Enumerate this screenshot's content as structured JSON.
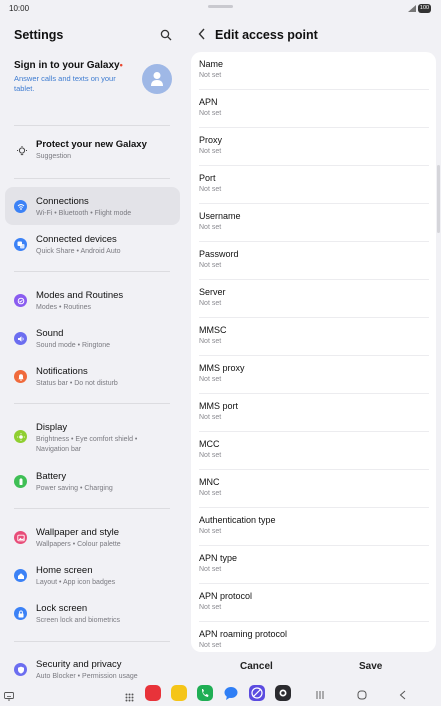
{
  "status_bar": {
    "time": "10:00",
    "battery": "100"
  },
  "settings": {
    "title": "Settings",
    "signin": {
      "title": "Sign in to your Galaxy",
      "subtitle": "Answer calls and texts on your tablet."
    },
    "suggestion": {
      "label": "Protect your new Galaxy",
      "sub": "Suggestion"
    },
    "items": [
      {
        "label": "Connections",
        "sub": "Wi-Fi  •  Bluetooth  •  Flight mode",
        "color": "#3c82f6",
        "icon": "wifi-icon"
      },
      {
        "label": "Connected devices",
        "sub": "Quick Share  •  Android Auto",
        "color": "#3c82f6",
        "icon": "connected-devices-icon"
      },
      {
        "label": "Modes and Routines",
        "sub": "Modes  •  Routines",
        "color": "#8a5cf0",
        "icon": "modes-icon"
      },
      {
        "label": "Sound",
        "sub": "Sound mode  •  Ringtone",
        "color": "#6c6ef0",
        "icon": "sound-icon"
      },
      {
        "label": "Notifications",
        "sub": "Status bar  •  Do not disturb",
        "color": "#f06a3c",
        "icon": "notifications-icon"
      },
      {
        "label": "Display",
        "sub": "Brightness  •  Eye comfort shield  •  Navigation bar",
        "color": "#8fcf30",
        "icon": "display-icon"
      },
      {
        "label": "Battery",
        "sub": "Power saving  •  Charging",
        "color": "#3fbf55",
        "icon": "battery-icon"
      },
      {
        "label": "Wallpaper and style",
        "sub": "Wallpapers  •  Colour palette",
        "color": "#e84d79",
        "icon": "wallpaper-icon"
      },
      {
        "label": "Home screen",
        "sub": "Layout  •  App icon badges",
        "color": "#3c82f6",
        "icon": "home-screen-icon"
      },
      {
        "label": "Lock screen",
        "sub": "Screen lock and biometrics",
        "color": "#3c82f6",
        "icon": "lock-icon"
      },
      {
        "label": "Security and privacy",
        "sub": "Auto Blocker  •  Permission usage",
        "color": "#6c6ef0",
        "icon": "security-icon"
      }
    ]
  },
  "edit_apn": {
    "title": "Edit access point",
    "fields": [
      {
        "label": "Name",
        "value": "Not set"
      },
      {
        "label": "APN",
        "value": "Not set"
      },
      {
        "label": "Proxy",
        "value": "Not set"
      },
      {
        "label": "Port",
        "value": "Not set"
      },
      {
        "label": "Username",
        "value": "Not set"
      },
      {
        "label": "Password",
        "value": "Not set"
      },
      {
        "label": "Server",
        "value": "Not set"
      },
      {
        "label": "MMSC",
        "value": "Not set"
      },
      {
        "label": "MMS proxy",
        "value": "Not set"
      },
      {
        "label": "MMS port",
        "value": "Not set"
      },
      {
        "label": "MCC",
        "value": "Not set"
      },
      {
        "label": "MNC",
        "value": "Not set"
      },
      {
        "label": "Authentication type",
        "value": "Not set"
      },
      {
        "label": "APN type",
        "value": "Not set"
      },
      {
        "label": "APN protocol",
        "value": "Not set"
      },
      {
        "label": "APN roaming protocol",
        "value": "Not set"
      }
    ],
    "cancel": "Cancel",
    "save": "Save"
  }
}
